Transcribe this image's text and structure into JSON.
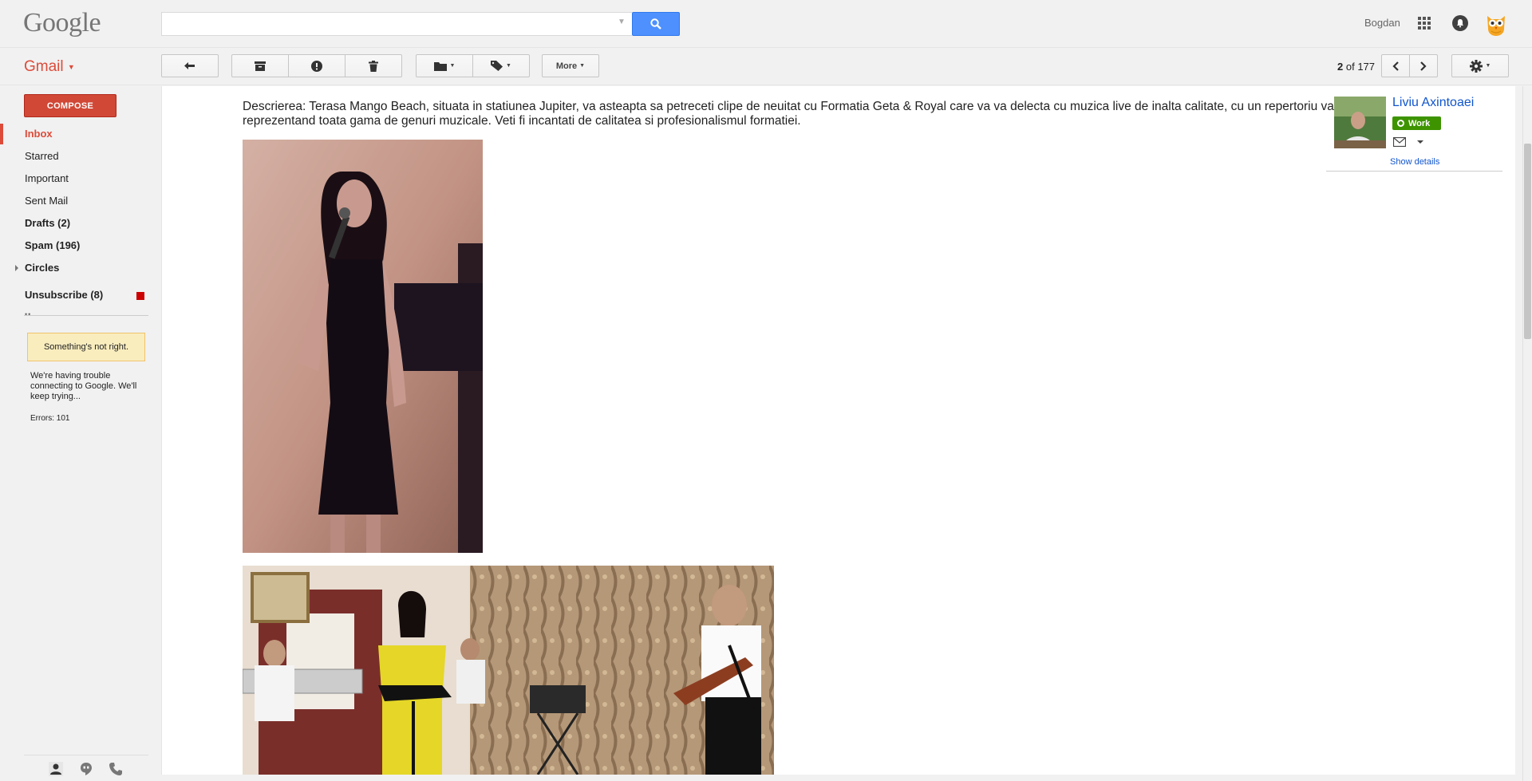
{
  "header": {
    "logo": "Google",
    "search": {
      "value": "",
      "placeholder": ""
    },
    "user_name": "Bogdan",
    "icons": [
      "search-icon",
      "apps-icon",
      "notifications-icon",
      "owl-avatar-icon"
    ]
  },
  "toolbar": {
    "app_label": "Gmail",
    "more_label": "More",
    "pager": {
      "current": "2",
      "of_label": "of",
      "total": "177"
    },
    "icons": [
      "back-arrow-icon",
      "archive-icon",
      "report-spam-icon",
      "delete-icon",
      "folder-icon",
      "label-icon",
      "chevron-left-icon",
      "chevron-right-icon",
      "gear-icon"
    ]
  },
  "sidebar": {
    "compose_label": "COMPOSE",
    "items": [
      {
        "label": "Inbox",
        "active": true
      },
      {
        "label": "Starred"
      },
      {
        "label": "Important"
      },
      {
        "label": "Sent Mail"
      },
      {
        "label": "Drafts (2)",
        "bold": true
      },
      {
        "label": "Spam (196)",
        "bold": true
      },
      {
        "label": "Circles",
        "bold": true
      },
      {
        "label": "Unsubscribe (8)",
        "bold": true
      }
    ],
    "error": {
      "title": "Something's not right.",
      "message": "We're having trouble connecting to Google. We'll keep trying...",
      "errors": "Errors: 101"
    },
    "footer_icons": [
      "person-icon",
      "hangouts-icon",
      "phone-icon"
    ]
  },
  "message": {
    "description": "Descrierea: Terasa Mango Beach, situata in statiunea Jupiter, va asteapta sa petreceti clipe de neuitat cu Formatia Geta & Royal care va va delecta cu muzica live de inalta calitate, cu un repertoriu variat reprezentand toata gama de genuri muzicale. Veti fi incantati de calitatea si profesionalismul formatiei."
  },
  "contact": {
    "name": "Liviu Axintoaei",
    "badge": "Work",
    "show_details": "Show details"
  },
  "colors": {
    "accent_red": "#dd4b39",
    "compose_red": "#d14836",
    "search_blue": "#4d90fe",
    "link_blue": "#1155cc",
    "work_green": "#3d9400",
    "warning_yellow": "#f9edbe"
  }
}
